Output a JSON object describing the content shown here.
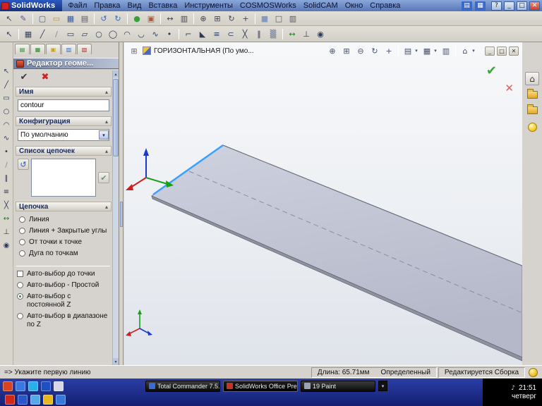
{
  "app": {
    "title": "SolidWorks"
  },
  "menu": {
    "items": [
      "Файл",
      "Правка",
      "Вид",
      "Вставка",
      "Инструменты",
      "COSMOSWorks",
      "SolidCAM",
      "Окно",
      "Справка"
    ]
  },
  "panel": {
    "title": "Редактор геоме...",
    "name_group": {
      "label": "Имя",
      "value": "contour"
    },
    "config_group": {
      "label": "Конфигурация",
      "value": "По умолчанию"
    },
    "chain_list_group": {
      "label": "Список цепочек"
    },
    "chain_group": {
      "label": "Цепочка",
      "options": [
        "Линия",
        "Линия + Закрытые углы",
        "От точки к точке",
        "Дуга по точкам"
      ]
    },
    "auto_group": {
      "checkbox": "Авто-выбор до точки",
      "options": [
        "Авто-выбор - Простой",
        "Авто-выбор с постоянной Z",
        "Авто-выбор в диапазоне по Z"
      ],
      "selected": "Авто-выбор с постоянной Z"
    }
  },
  "viewport": {
    "doc_title": "ГОРИЗОНТАЛЬНАЯ (По умо..."
  },
  "statusbar": {
    "prompt": "=> Укажите первую линию",
    "length": "Длина: 65.71мм",
    "state": "Определенный",
    "mode": "Редактируется Сборка"
  },
  "taskbar": {
    "tasks": [
      {
        "label": "Total Commander 7.5..."
      },
      {
        "label": "SolidWorks Office Pre..."
      },
      {
        "label": "19 Paint"
      }
    ],
    "tray": {
      "time": "21:51",
      "day": "четверг"
    }
  },
  "colors": {
    "selected_edge": "#3aa0ff",
    "plate": "#c3c6d4",
    "taskbar": "#1c2f84",
    "titlebar": "#5876b6"
  },
  "glyphs": {
    "chevron_up": "▴",
    "dropdown": "▾",
    "undo": "↺",
    "check": "✔",
    "cross": "✕",
    "note": "♪"
  },
  "icons": {
    "titlebar_tools": [
      {
        "name": "workgroup-pdm-icon",
        "glyph": "▤",
        "color": "#fff",
        "bg": "#3a6ac8"
      },
      {
        "name": "help-topics-icon",
        "glyph": "▦",
        "color": "#fff",
        "bg": "#3a6ac8"
      }
    ],
    "window_controls": [
      {
        "name": "help-button",
        "glyph": "?"
      },
      {
        "name": "minimize-button",
        "glyph": "_"
      },
      {
        "name": "maximize-button",
        "glyph": "□"
      },
      {
        "name": "close-button",
        "glyph": "✕",
        "cls": "close"
      }
    ],
    "toolbar1": [
      {
        "name": "select-tool-icon",
        "glyph": "↖",
        "color": "#404a5a"
      },
      {
        "name": "sketch-icon",
        "glyph": "✎",
        "color": "#6a4a9a"
      },
      {
        "sep": true
      },
      {
        "name": "new-document-icon",
        "glyph": "▢",
        "color": "#44608a"
      },
      {
        "name": "open-document-icon",
        "glyph": "▭",
        "color": "#c89018"
      },
      {
        "name": "save-icon",
        "glyph": "▦",
        "color": "#3858a8"
      },
      {
        "name": "print-icon",
        "glyph": "▤",
        "color": "#556"
      },
      {
        "sep": true
      },
      {
        "name": "undo-icon",
        "glyph": "↺",
        "color": "#3868b8"
      },
      {
        "name": "redo-icon",
        "glyph": "↻",
        "color": "#3868b8"
      },
      {
        "sep": true
      },
      {
        "name": "rebuild-icon",
        "glyph": "●",
        "color": "#38a038"
      },
      {
        "name": "edit-color-icon",
        "glyph": "▣",
        "color": "#b05838"
      },
      {
        "sep": true
      },
      {
        "name": "measure-icon",
        "glyph": "↔",
        "color": "#445"
      },
      {
        "name": "mass-properties-icon",
        "glyph": "▥",
        "color": "#445"
      },
      {
        "sep": true
      },
      {
        "name": "zoom-fit-icon",
        "glyph": "⊕",
        "color": "#445"
      },
      {
        "name": "zoom-area-icon",
        "glyph": "⊞",
        "color": "#445"
      },
      {
        "name": "rotate-view-icon",
        "glyph": "↻",
        "color": "#445"
      },
      {
        "name": "pan-icon",
        "glyph": "+",
        "color": "#445"
      },
      {
        "sep": true
      },
      {
        "name": "shaded-view-icon",
        "glyph": "■",
        "color": "#8898c0"
      },
      {
        "name": "wireframe-view-icon",
        "glyph": "□",
        "color": "#556"
      },
      {
        "name": "section-view-icon",
        "glyph": "▥",
        "color": "#556"
      }
    ],
    "toolbar2": [
      {
        "name": "select-icon",
        "glyph": "↖",
        "color": "#3a4660"
      },
      {
        "sep": true
      },
      {
        "name": "sketch-grid-icon",
        "glyph": "▦",
        "color": "#3a4660"
      },
      {
        "name": "line-icon",
        "glyph": "╱",
        "color": "#2a3a5a"
      },
      {
        "name": "centerline-icon",
        "glyph": "∕",
        "color": "#7a8aa8"
      },
      {
        "name": "rectangle-icon",
        "glyph": "▭",
        "color": "#2a3a5a"
      },
      {
        "name": "parallelogram-icon",
        "glyph": "▱",
        "color": "#2a3a5a"
      },
      {
        "name": "circle-icon",
        "glyph": "○",
        "color": "#2a3a5a"
      },
      {
        "name": "ellipse-icon",
        "glyph": "◯",
        "color": "#2a3a5a"
      },
      {
        "name": "arc-icon",
        "glyph": "◠",
        "color": "#2a3a5a"
      },
      {
        "name": "tangent-arc-icon",
        "glyph": "◡",
        "color": "#2a3a5a"
      },
      {
        "name": "spline-icon",
        "glyph": "∿",
        "color": "#2a3a5a"
      },
      {
        "name": "point-icon",
        "glyph": "•",
        "color": "#2a3a5a"
      },
      {
        "sep": true
      },
      {
        "name": "fillet-icon",
        "glyph": "⌐",
        "color": "#2a3a5a"
      },
      {
        "name": "chamfer-icon",
        "glyph": "◣",
        "color": "#2a3a5a"
      },
      {
        "name": "offset-icon",
        "glyph": "≡",
        "color": "#2a3a5a"
      },
      {
        "name": "convert-entities-icon",
        "glyph": "⊂",
        "color": "#2a3a5a"
      },
      {
        "name": "trim-icon",
        "glyph": "╳",
        "color": "#2a3a5a"
      },
      {
        "name": "mirror-icon",
        "glyph": "∥",
        "color": "#2a3a5a"
      },
      {
        "name": "linear-pattern-icon",
        "glyph": "▒",
        "color": "#5a6a8a"
      },
      {
        "sep": true
      },
      {
        "name": "dimension-icon",
        "glyph": "↔",
        "color": "#2a7a2a"
      },
      {
        "name": "add-relation-icon",
        "glyph": "⊥",
        "color": "#2a3a5a"
      },
      {
        "name": "display-relations-icon",
        "glyph": "◉",
        "color": "#2a3a5a"
      }
    ],
    "left_toolbar": [
      {
        "name": "select-arrow-icon",
        "glyph": "↖",
        "color": "#3a4660"
      },
      {
        "name": "line-tool-icon",
        "glyph": "╱",
        "color": "#2a3a5a"
      },
      {
        "name": "rectangle-tool-icon",
        "glyph": "▭",
        "color": "#2a3a5a"
      },
      {
        "name": "circle-tool-icon",
        "glyph": "○",
        "color": "#2a3a5a"
      },
      {
        "name": "arc-tool-icon",
        "glyph": "◠",
        "color": "#2a3a5a"
      },
      {
        "name": "spline-tool-icon",
        "glyph": "∿",
        "color": "#2a3a5a"
      },
      {
        "name": "point-tool-icon",
        "glyph": "•",
        "color": "#2a3a5a"
      },
      {
        "name": "centerline-tool-icon",
        "glyph": "∕",
        "color": "#7a8aa8"
      },
      {
        "name": "mirror-tool-icon",
        "glyph": "∥",
        "color": "#2a3a5a"
      },
      {
        "name": "offset-tool-icon",
        "glyph": "≡",
        "color": "#2a3a5a"
      },
      {
        "name": "trim-tool-icon",
        "glyph": "╳",
        "color": "#2a3a5a"
      },
      {
        "name": "dimension-tool-icon",
        "glyph": "↔",
        "color": "#2a7a2a"
      },
      {
        "name": "relation-tool-icon",
        "glyph": "⊥",
        "color": "#2a3a5a"
      },
      {
        "name": "snap-tool-icon",
        "glyph": "◉",
        "color": "#2a3a5a"
      }
    ],
    "panel_tabs": [
      {
        "name": "tab-featuremanager-icon",
        "glyph": "▤",
        "color": "#2a8a2a"
      },
      {
        "name": "tab-propertymanager-icon",
        "glyph": "▦",
        "color": "#2a8a2a"
      },
      {
        "name": "tab-configurationmanager-icon",
        "glyph": "▣",
        "color": "#caa020"
      },
      {
        "name": "tab-dimxpert-icon",
        "glyph": "▥",
        "color": "#2a6ac8"
      },
      {
        "name": "tab-displaymanager-icon",
        "glyph": "▧",
        "color": "#b03030"
      }
    ],
    "panel_actions": [
      {
        "name": "ok-button",
        "glyph": "✔",
        "cls": "okg"
      },
      {
        "name": "cancel-button",
        "glyph": "✖",
        "cls": "cxg"
      }
    ],
    "doc_lead": [
      {
        "name": "viewport-splitter-icon",
        "glyph": "⊞",
        "color": "#667"
      }
    ],
    "view_toolbar": [
      {
        "name": "zoom-fit-icon",
        "glyph": "⊕"
      },
      {
        "name": "zoom-area-icon",
        "glyph": "⊞"
      },
      {
        "name": "zoom-out-icon",
        "glyph": "⊖"
      },
      {
        "name": "rotate-view-icon",
        "glyph": "↻"
      },
      {
        "name": "pan-icon",
        "glyph": "+"
      },
      {
        "sep": true
      },
      {
        "name": "standard-views-icon",
        "glyph": "▤"
      },
      {
        "name": "dropdown-arrow-icon",
        "glyph": "▾",
        "drop": true
      },
      {
        "name": "display-style-icon",
        "glyph": "▦"
      },
      {
        "name": "dropdown-arrow-icon",
        "glyph": "▾",
        "drop": true
      },
      {
        "name": "section-view-icon",
        "glyph": "▥"
      },
      {
        "sep": true
      },
      {
        "name": "view-orientation-icon",
        "glyph": "⌂"
      },
      {
        "name": "dropdown-arrow-icon",
        "glyph": "▾",
        "drop": true
      }
    ],
    "doc_controls": [
      {
        "name": "doc-minimize-button",
        "glyph": "_"
      },
      {
        "name": "doc-restore-button",
        "glyph": "□"
      },
      {
        "name": "doc-close-button",
        "glyph": "✕"
      }
    ],
    "right_strip": [
      {
        "name": "home-icon",
        "glyph": "⌂",
        "cls": "rbtn"
      },
      {
        "name": "file-explorer-folder-icon",
        "cls": "folder"
      },
      {
        "name": "search-folder-icon",
        "cls": "folder"
      },
      {
        "name": "lightbulb-icon",
        "cls": "bulb"
      }
    ],
    "quick_launch_1": [
      {
        "name": "quick-launch-1-icon",
        "cls": "qi",
        "bg": "#d84420"
      },
      {
        "name": "quick-launch-2-icon",
        "cls": "qi",
        "bg": "#3a7ae0"
      },
      {
        "name": "quick-launch-3-icon",
        "cls": "qi",
        "bg": "#28b0e8"
      },
      {
        "name": "quick-launch-4-icon",
        "cls": "qi",
        "bg": "#2050c0"
      },
      {
        "name": "quick-launch-5-icon",
        "cls": "qi",
        "bg": "#d8d8e8"
      }
    ],
    "quick_launch_2": [
      {
        "name": "quick-launch-6-icon",
        "cls": "qi",
        "bg": "#d02818"
      },
      {
        "name": "quick-launch-7-icon",
        "cls": "qi",
        "bg": "#2858c8"
      },
      {
        "name": "quick-launch-8-icon",
        "cls": "qi",
        "bg": "#58a8e8"
      },
      {
        "name": "quick-launch-9-icon",
        "cls": "qi",
        "bg": "#e8b820"
      },
      {
        "name": "quick-launch-10-icon",
        "cls": "qi",
        "bg": "#3878d8"
      }
    ]
  }
}
